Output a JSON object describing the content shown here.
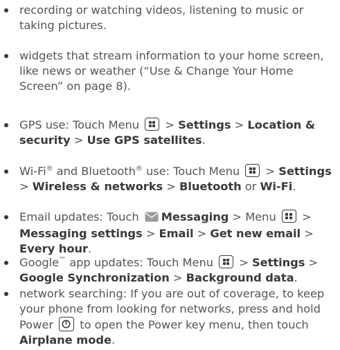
{
  "bullets": [
    {
      "parts": [
        {
          "t": "text",
          "v": "recording or watching videos, listening to music or taking pictures."
        }
      ]
    },
    {
      "parts": [
        {
          "t": "text",
          "v": "widgets that stream information to your home screen, like news or weather (“Use & Change Your Home Screen” on page 8)."
        }
      ]
    },
    {
      "parts": [
        {
          "t": "text",
          "v": "GPS use: Touch Menu "
        },
        {
          "t": "icon",
          "icon": "menu-key-icon"
        },
        {
          "t": "text",
          "v": " > "
        },
        {
          "t": "bold",
          "v": "Settings"
        },
        {
          "t": "text",
          "v": " > "
        },
        {
          "t": "bold",
          "v": "Location & security"
        },
        {
          "t": "text",
          "v": " > "
        },
        {
          "t": "bold",
          "v": "Use GPS satellites"
        },
        {
          "t": "text",
          "v": "."
        }
      ]
    },
    {
      "parts": [
        {
          "t": "text",
          "v": "Wi-Fi"
        },
        {
          "t": "sup",
          "v": "®"
        },
        {
          "t": "text",
          "v": " and Bluetooth"
        },
        {
          "t": "sup",
          "v": "®"
        },
        {
          "t": "text",
          "v": " use: Touch Menu "
        },
        {
          "t": "icon",
          "icon": "menu-key-icon"
        },
        {
          "t": "text",
          "v": " > "
        },
        {
          "t": "bold",
          "v": "Settings"
        },
        {
          "t": "text",
          "v": " > "
        },
        {
          "t": "bold",
          "v": "Wireless & networks"
        },
        {
          "t": "text",
          "v": " > "
        },
        {
          "t": "bold",
          "v": "Bluetooth"
        },
        {
          "t": "text",
          "v": " or "
        },
        {
          "t": "bold",
          "v": "Wi-Fi"
        },
        {
          "t": "text",
          "v": "."
        }
      ]
    },
    {
      "parts": [
        {
          "t": "text",
          "v": "Email updates: Touch "
        },
        {
          "t": "icon",
          "icon": "envelope-icon"
        },
        {
          "t": "bold",
          "v": "Messaging"
        },
        {
          "t": "text",
          "v": " > Menu "
        },
        {
          "t": "icon",
          "icon": "menu-key-icon"
        },
        {
          "t": "text",
          "v": " > "
        },
        {
          "t": "bold",
          "v": "Messaging settings"
        },
        {
          "t": "text",
          "v": " > "
        },
        {
          "t": "bold",
          "v": "Email"
        },
        {
          "t": "text",
          "v": " > "
        },
        {
          "t": "bold",
          "v": "Get new email"
        },
        {
          "t": "text",
          "v": " > "
        },
        {
          "t": "bold",
          "v": "Every hour"
        },
        {
          "t": "text",
          "v": "."
        }
      ]
    },
    {
      "parts": [
        {
          "t": "text",
          "v": "Google"
        },
        {
          "t": "sup",
          "v": "™"
        },
        {
          "t": "text",
          "v": " app updates: Touch Menu "
        },
        {
          "t": "icon",
          "icon": "menu-key-icon"
        },
        {
          "t": "text",
          "v": " > "
        },
        {
          "t": "bold",
          "v": "Settings"
        },
        {
          "t": "text",
          "v": " > "
        },
        {
          "t": "bold",
          "v": "Google Synchronization"
        },
        {
          "t": "text",
          "v": " > "
        },
        {
          "t": "bold",
          "v": "Background data"
        },
        {
          "t": "text",
          "v": "."
        }
      ]
    },
    {
      "parts": [
        {
          "t": "text",
          "v": "network searching: If you are out of coverage, to keep your phone from looking for networks, press and hold Power "
        },
        {
          "t": "icon",
          "icon": "power-key-icon"
        },
        {
          "t": "text",
          "v": " to open the Power key menu, then touch "
        },
        {
          "t": "bold",
          "v": "Airplane mode"
        },
        {
          "t": "text",
          "v": "."
        }
      ]
    }
  ]
}
